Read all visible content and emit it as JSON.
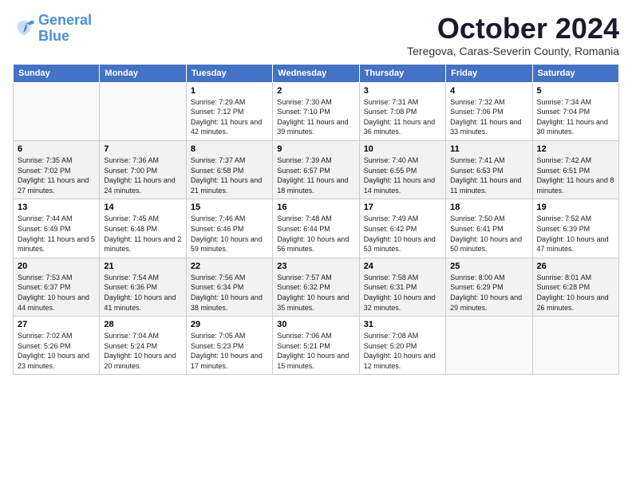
{
  "logo": {
    "line1": "General",
    "line2": "Blue"
  },
  "title": "October 2024",
  "subtitle": "Teregova, Caras-Severin County, Romania",
  "days_header": [
    "Sunday",
    "Monday",
    "Tuesday",
    "Wednesday",
    "Thursday",
    "Friday",
    "Saturday"
  ],
  "weeks": [
    [
      {
        "day": "",
        "info": ""
      },
      {
        "day": "",
        "info": ""
      },
      {
        "day": "1",
        "info": "Sunrise: 7:29 AM\nSunset: 7:12 PM\nDaylight: 11 hours and 42 minutes."
      },
      {
        "day": "2",
        "info": "Sunrise: 7:30 AM\nSunset: 7:10 PM\nDaylight: 11 hours and 39 minutes."
      },
      {
        "day": "3",
        "info": "Sunrise: 7:31 AM\nSunset: 7:08 PM\nDaylight: 11 hours and 36 minutes."
      },
      {
        "day": "4",
        "info": "Sunrise: 7:32 AM\nSunset: 7:06 PM\nDaylight: 11 hours and 33 minutes."
      },
      {
        "day": "5",
        "info": "Sunrise: 7:34 AM\nSunset: 7:04 PM\nDaylight: 11 hours and 30 minutes."
      }
    ],
    [
      {
        "day": "6",
        "info": "Sunrise: 7:35 AM\nSunset: 7:02 PM\nDaylight: 11 hours and 27 minutes."
      },
      {
        "day": "7",
        "info": "Sunrise: 7:36 AM\nSunset: 7:00 PM\nDaylight: 11 hours and 24 minutes."
      },
      {
        "day": "8",
        "info": "Sunrise: 7:37 AM\nSunset: 6:58 PM\nDaylight: 11 hours and 21 minutes."
      },
      {
        "day": "9",
        "info": "Sunrise: 7:39 AM\nSunset: 6:57 PM\nDaylight: 11 hours and 18 minutes."
      },
      {
        "day": "10",
        "info": "Sunrise: 7:40 AM\nSunset: 6:55 PM\nDaylight: 11 hours and 14 minutes."
      },
      {
        "day": "11",
        "info": "Sunrise: 7:41 AM\nSunset: 6:53 PM\nDaylight: 11 hours and 11 minutes."
      },
      {
        "day": "12",
        "info": "Sunrise: 7:42 AM\nSunset: 6:51 PM\nDaylight: 11 hours and 8 minutes."
      }
    ],
    [
      {
        "day": "13",
        "info": "Sunrise: 7:44 AM\nSunset: 6:49 PM\nDaylight: 11 hours and 5 minutes."
      },
      {
        "day": "14",
        "info": "Sunrise: 7:45 AM\nSunset: 6:48 PM\nDaylight: 11 hours and 2 minutes."
      },
      {
        "day": "15",
        "info": "Sunrise: 7:46 AM\nSunset: 6:46 PM\nDaylight: 10 hours and 59 minutes."
      },
      {
        "day": "16",
        "info": "Sunrise: 7:48 AM\nSunset: 6:44 PM\nDaylight: 10 hours and 56 minutes."
      },
      {
        "day": "17",
        "info": "Sunrise: 7:49 AM\nSunset: 6:42 PM\nDaylight: 10 hours and 53 minutes."
      },
      {
        "day": "18",
        "info": "Sunrise: 7:50 AM\nSunset: 6:41 PM\nDaylight: 10 hours and 50 minutes."
      },
      {
        "day": "19",
        "info": "Sunrise: 7:52 AM\nSunset: 6:39 PM\nDaylight: 10 hours and 47 minutes."
      }
    ],
    [
      {
        "day": "20",
        "info": "Sunrise: 7:53 AM\nSunset: 6:37 PM\nDaylight: 10 hours and 44 minutes."
      },
      {
        "day": "21",
        "info": "Sunrise: 7:54 AM\nSunset: 6:36 PM\nDaylight: 10 hours and 41 minutes."
      },
      {
        "day": "22",
        "info": "Sunrise: 7:56 AM\nSunset: 6:34 PM\nDaylight: 10 hours and 38 minutes."
      },
      {
        "day": "23",
        "info": "Sunrise: 7:57 AM\nSunset: 6:32 PM\nDaylight: 10 hours and 35 minutes."
      },
      {
        "day": "24",
        "info": "Sunrise: 7:58 AM\nSunset: 6:31 PM\nDaylight: 10 hours and 32 minutes."
      },
      {
        "day": "25",
        "info": "Sunrise: 8:00 AM\nSunset: 6:29 PM\nDaylight: 10 hours and 29 minutes."
      },
      {
        "day": "26",
        "info": "Sunrise: 8:01 AM\nSunset: 6:28 PM\nDaylight: 10 hours and 26 minutes."
      }
    ],
    [
      {
        "day": "27",
        "info": "Sunrise: 7:02 AM\nSunset: 5:26 PM\nDaylight: 10 hours and 23 minutes."
      },
      {
        "day": "28",
        "info": "Sunrise: 7:04 AM\nSunset: 5:24 PM\nDaylight: 10 hours and 20 minutes."
      },
      {
        "day": "29",
        "info": "Sunrise: 7:05 AM\nSunset: 5:23 PM\nDaylight: 10 hours and 17 minutes."
      },
      {
        "day": "30",
        "info": "Sunrise: 7:06 AM\nSunset: 5:21 PM\nDaylight: 10 hours and 15 minutes."
      },
      {
        "day": "31",
        "info": "Sunrise: 7:08 AM\nSunset: 5:20 PM\nDaylight: 10 hours and 12 minutes."
      },
      {
        "day": "",
        "info": ""
      },
      {
        "day": "",
        "info": ""
      }
    ]
  ]
}
